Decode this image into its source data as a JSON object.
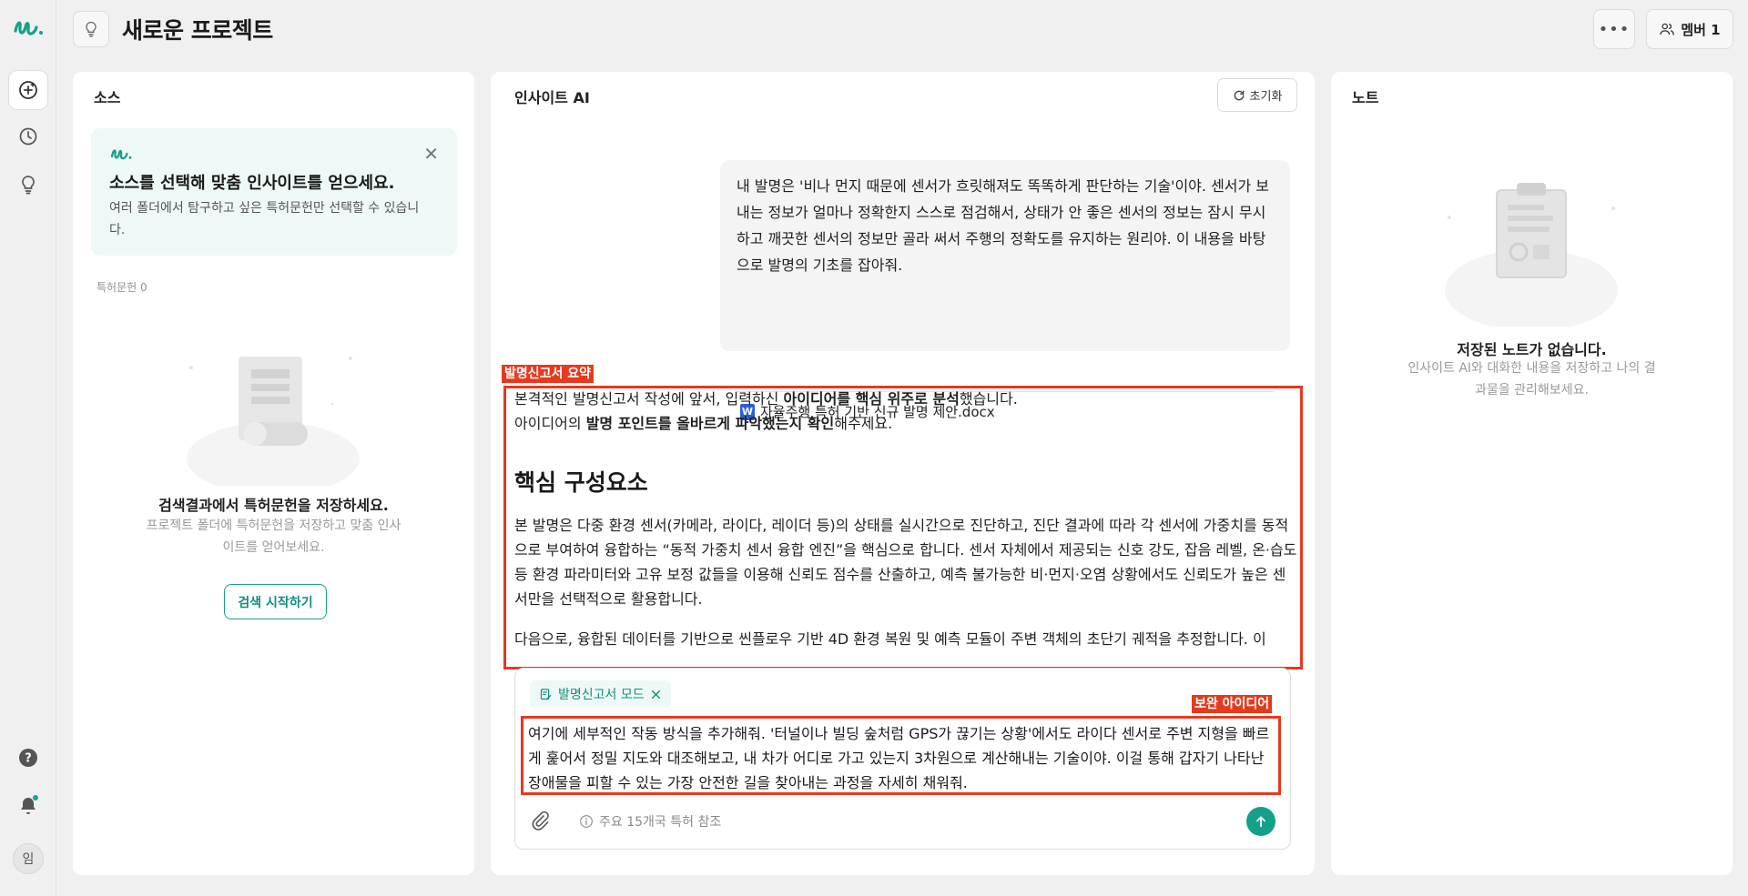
{
  "project": {
    "title": "새로운 프로젝트",
    "more_label": "•••",
    "member_label": "멤버 1"
  },
  "rail": {
    "avatar_initial": "임"
  },
  "source": {
    "title": "소스",
    "tip_title": "소스를 선택해 맞춤 인사이트를 얻으세요.",
    "tip_desc": "여러 폴더에서 탐구하고 싶은 특허문헌만 선택할 수 있습니다.",
    "tip_close": "✕",
    "count_label": "특허문헌 0",
    "empty_title": "검색결과에서 특허문헌을 저장하세요.",
    "empty_desc": "프로젝트 폴더에 특허문헌을 저장하고 맞춤 인사이트를 얻어보세요.",
    "search_button": "검색 시작하기"
  },
  "insight": {
    "title": "인사이트 AI",
    "reset_label": "초기화",
    "user_message": "내 발명은 '비나 먼지 때문에 센서가 흐릿해져도 똑똑하게 판단하는 기술'이야. 센서가 보내는 정보가 얼마나 정확한지 스스로 점검해서, 상태가 안 좋은 센서의 정보는 잠시 무시하고 깨끗한 센서의 정보만 골라 써서 주행의 정확도를 유지하는 원리야. 이 내용을 바탕으로 발명의 기초를 잡아줘.",
    "attachment_name": "자율주행 특허 기반 신규 발명 제안.docx",
    "attachment_icon": "W",
    "summary_label": "발명신고서 요약",
    "summary_line1_pre": "본격적인 발명신고서 작성에 앞서, 입력하신 ",
    "summary_line1_bold": "아이디어를 핵심 위주로 분석",
    "summary_line1_post": "했습니다.",
    "summary_line2_pre": "아이디어의 ",
    "summary_line2_bold": "발명 포인트를 올바르게 파악했는지 확인",
    "summary_line2_post": "해주세요.",
    "core_title": "핵심 구성요소",
    "core_para": "본 발명은 다중 환경 센서(카메라, 라이다, 레이더 등)의 상태를 실시간으로 진단하고, 진단 결과에 따라 각 센서에 가중치를 동적으로 부여하여 융합하는 “동적 가중치 센서 융합 엔진”을 핵심으로 합니다. 센서 자체에서 제공되는 신호 강도, 잡음 레벨, 온·습도 등 환경 파라미터와 고유 보정 값들을 이용해 신뢰도 점수를 산출하고, 예측 불가능한 비·먼지·오염 상황에서도 신뢰도가 높은 센서만을 선택적으로 활용합니다.",
    "core_para2": "다음으로, 융합된 데이터를 기반으로 씬플로우 기반 4D 환경 복원 및 예측 모듈이 주변 객체의 초단기 궤적을 추정합니다. 이",
    "mode_chip": "발명신고서 모드",
    "composer_label": "보완 아이디어",
    "composer_text": "여기에 세부적인 작동 방식을 추가해줘. '터널이나 빌딩 숲처럼 GPS가 끊기는 상황'에서도 라이다 센서로 주변 지형을 빠르게 훑어서 정밀 지도와 대조해보고, 내 차가 어디로 가고 있는지 3차원으로 계산해내는 기술이야. 이걸 통해 갑자기 나타난 장애물을 피할 수 있는 가장 안전한 길을 찾아내는 과정을 자세히 채워줘.",
    "reference_text": "주요 15개국 특허 참조"
  },
  "notes": {
    "title": "노트",
    "empty_title": "저장된 노트가 없습니다.",
    "empty_desc": "인사이트 AI와 대화한 내용을 저장하고 나의 결과물을 관리해보세요."
  },
  "colors": {
    "accent": "#14a08a",
    "highlight": "#e8391d",
    "background": "#f0f0f0"
  }
}
